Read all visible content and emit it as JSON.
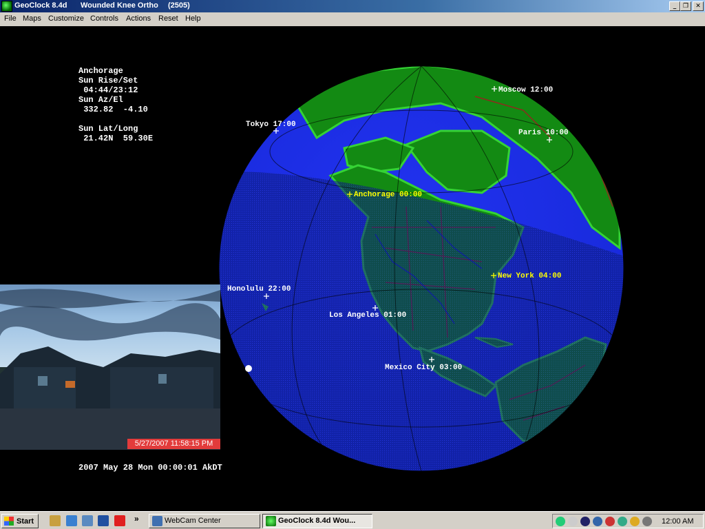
{
  "window": {
    "app_title": "GeoClock 8.4d",
    "doc_title": "Wounded Knee Ortho",
    "doc_number": "(2505)",
    "controls": {
      "minimize": "_",
      "maximize": "❐",
      "close": "✕"
    }
  },
  "menu": [
    "File",
    "Maps",
    "Customize",
    "Controls",
    "Actions",
    "Reset",
    "Help"
  ],
  "info": {
    "location": "Anchorage",
    "sun_rise_set_label": "Sun Rise/Set",
    "sun_rise_set": " 04:44/23:12",
    "sun_az_el_label": "Sun Az/El",
    "sun_az_el": " 332.82  -4.10",
    "sun_lat_long_label": "Sun Lat/Long",
    "sun_lat_long": " 21.42N  59.30E"
  },
  "cities": [
    {
      "name": "Tokyo 17:00",
      "color": "#ffffff"
    },
    {
      "name": "Moscow 12:00",
      "color": "#ffffff"
    },
    {
      "name": "Paris 10:00",
      "color": "#ffffff"
    },
    {
      "name": "Anchorage 00:00",
      "color": "#ffff00"
    },
    {
      "name": "Honolulu 22:00",
      "color": "#ffffff"
    },
    {
      "name": "New York 04:00",
      "color": "#ffff00"
    },
    {
      "name": "Los Angeles 01:00",
      "color": "#ffffff"
    },
    {
      "name": "Mexico City 03:00",
      "color": "#ffffff"
    }
  ],
  "webcam": {
    "timestamp": "5/27/2007  11:58:15 PM"
  },
  "clock_line": "2007 May 28 Mon 00:00:01 AkDT",
  "taskbar": {
    "start": "Start",
    "tasks": [
      {
        "label": "WebCam Center",
        "active": false
      },
      {
        "label": "GeoClock 8.4d     Wou...",
        "active": true
      }
    ],
    "overflow": "»",
    "clock": "12:00 AM"
  },
  "colors": {
    "ocean": "#1a2ee6",
    "land": "#138a13",
    "highland": "#35d335",
    "night_shade": "#0a0a55",
    "borders": "#b01020",
    "rivers": "#1020c0"
  }
}
